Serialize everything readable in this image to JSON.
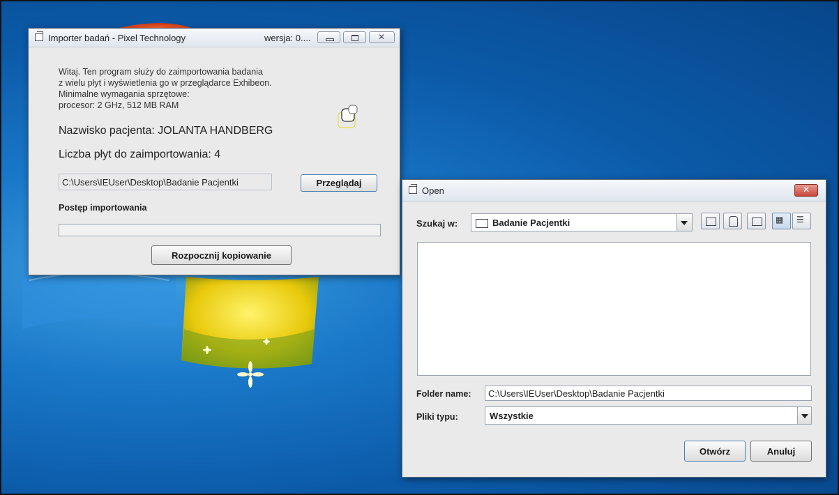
{
  "importer": {
    "title": "Importer badań - Pixel Technology",
    "version": "wersja: 0....",
    "intro_lines": [
      "Witaj. Ten program służy do zaimportowania badania",
      "z wielu płyt i wyświetlenia go w przeglądarce Exhibeon.",
      "Minimalne wymagania sprzętowe:",
      "procesor: 2 GHz, 512 MB RAM"
    ],
    "patient_name": "Nazwisko pacjenta: JOLANTA HANDBERG",
    "disc_count": "Liczba płyt do zaimportowania: 4",
    "path_value": "C:\\Users\\IEUser\\Desktop\\Badanie Pacjentki",
    "browse_label": "Przeglądaj",
    "progress_label": "Postęp importowania",
    "progress_value": 0,
    "start_label": "Rozpocznij kopiowanie"
  },
  "open_dialog": {
    "title": "Open",
    "look_in_label": "Szukaj w:",
    "look_in_value": "Badanie Pacjentki",
    "toolbar_icons": [
      "up-folder-icon",
      "home-icon",
      "new-folder-icon",
      "list-view-icon",
      "details-view-icon"
    ],
    "folder_name_label": "Folder name:",
    "folder_name_value": "C:\\Users\\IEUser\\Desktop\\Badanie Pacjentki",
    "file_type_label": "Pliki typu:",
    "file_type_value": "Wszystkie",
    "open_label": "Otwórz",
    "cancel_label": "Anuluj"
  },
  "colors": {
    "desktop_blue": "#0b5aa8",
    "window_bg": "#eaeaea",
    "close_red": "#c9463d"
  }
}
